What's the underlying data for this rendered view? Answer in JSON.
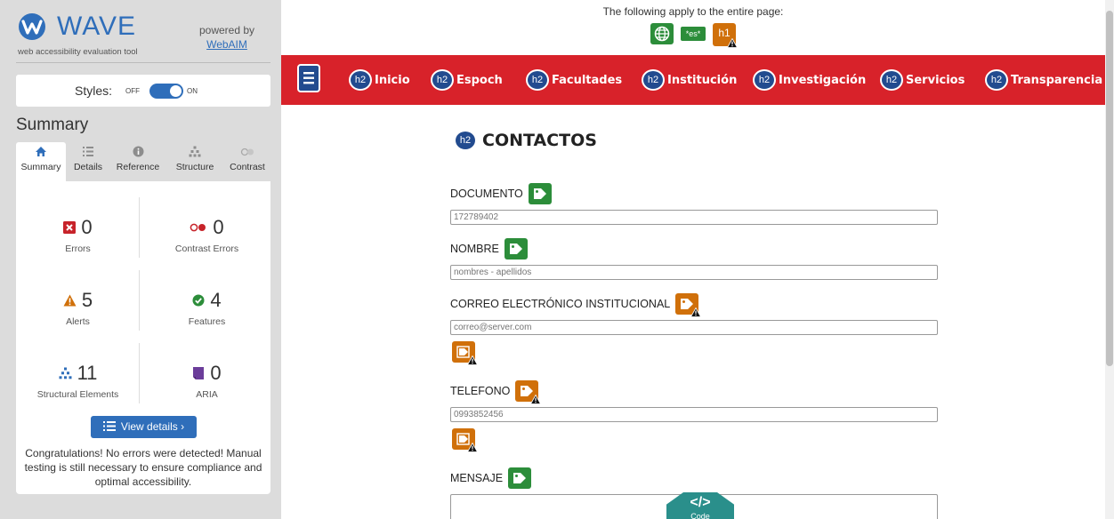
{
  "wave": {
    "name": "WAVE",
    "tagline": "web accessibility evaluation tool",
    "powered_by": "powered by",
    "webaim_link": "WebAIM",
    "styles_label": "Styles:",
    "toggle_off": "OFF",
    "toggle_on": "ON",
    "summary_heading": "Summary",
    "tabs": [
      {
        "label": "Summary",
        "icon": "home-icon",
        "active": true
      },
      {
        "label": "Details",
        "icon": "list-icon"
      },
      {
        "label": "Reference",
        "icon": "info-icon"
      },
      {
        "label": "Structure",
        "icon": "structure-icon"
      },
      {
        "label": "Contrast",
        "icon": "contrast-icon"
      }
    ],
    "stats": {
      "errors": {
        "count": "0",
        "label": "Errors"
      },
      "contrast_errors": {
        "count": "0",
        "label": "Contrast Errors"
      },
      "alerts": {
        "count": "5",
        "label": "Alerts"
      },
      "features": {
        "count": "4",
        "label": "Features"
      },
      "structural": {
        "count": "11",
        "label": "Structural Elements"
      },
      "aria": {
        "count": "0",
        "label": "ARIA"
      }
    },
    "view_details": "View details ›",
    "congrats": "Congratulations! No errors were detected! Manual testing is still necessary to ensure compliance and optimal accessibility."
  },
  "page_notice": {
    "text": "The following apply to the entire page:",
    "lang_badge": "*es*",
    "h1_badge": "h1"
  },
  "nav": {
    "badge": "h2",
    "items": [
      "Inicio",
      "Espoch",
      "Facultades",
      "Institución",
      "Investigación",
      "Servicios",
      "Transparencia"
    ]
  },
  "content": {
    "title": "CONTACTOS",
    "fields": [
      {
        "label": "DOCUMENTO",
        "value": "172789402"
      },
      {
        "label": "NOMBRE",
        "placeholder": "nombres - apellidos"
      },
      {
        "label": "CORREO ELECTRÓNICO INSTITUCIONAL",
        "placeholder": "correo@server.com"
      },
      {
        "label": "TELEFONO",
        "value": "0993852456"
      },
      {
        "label": "MENSAJE"
      }
    ],
    "code_button": "Code"
  },
  "colors": {
    "nav_red": "#d8222a",
    "wave_blue": "#2f6eba",
    "badge_navy": "#224b8f",
    "feature_green": "#2c8d3a",
    "alert_orange": "#d0700a",
    "error_red": "#c7232a",
    "aria_purple": "#6b3d9a",
    "code_teal": "#2a8f8b"
  }
}
